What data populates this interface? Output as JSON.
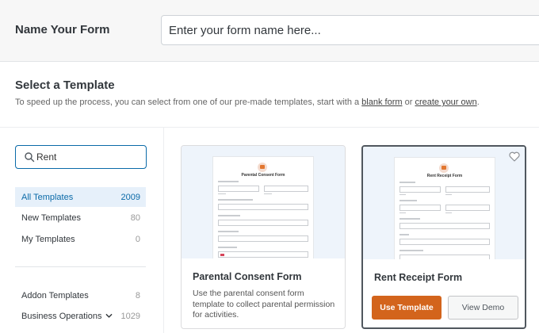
{
  "name_form": {
    "label": "Name Your Form",
    "placeholder": "Enter your form name here...",
    "value": ""
  },
  "templates_section": {
    "title": "Select a Template",
    "subtitle_pre": "To speed up the process, you can select from one of our pre-made templates, start with a ",
    "blank_link": "blank form",
    "subtitle_mid": " or ",
    "own_link": "create your own",
    "subtitle_post": "."
  },
  "search": {
    "value": "Rent",
    "icon": "search-icon"
  },
  "categories": [
    {
      "label": "All Templates",
      "count": "2009",
      "active": true
    },
    {
      "label": "New Templates",
      "count": "80"
    },
    {
      "label": "My Templates",
      "count": "0"
    },
    {
      "label": "Addon Templates",
      "count": "8"
    },
    {
      "label": "Business Operations",
      "count": "1029",
      "icon": "chevron-down-icon"
    }
  ],
  "cards": [
    {
      "title": "Parental Consent Form",
      "description": "Use the parental consent form template to collect parental permission for activities.",
      "preview": {
        "form_title": "Parental Consent Form",
        "fields": [
          "Child's Name *",
          "First",
          "Last",
          "Child Classroom / Teacher",
          "Parent Name *",
          "Parent Email *",
          "Parent Phone",
          "Permission for Conduct / Activities"
        ]
      }
    },
    {
      "title": "Rent Receipt Form",
      "preview": {
        "form_title": "Rent Receipt Form",
        "fields": [
          "Date / Time",
          "Date",
          "Time",
          "Tenant Name",
          "First",
          "Last",
          "Tenant Email *",
          "Unit #",
          "Property Address",
          "Address Line 1"
        ]
      },
      "use_label": "Use Template",
      "demo_label": "View Demo",
      "favorite_icon": "heart-icon"
    }
  ],
  "colors": {
    "accent": "#0a6aa8",
    "primary_button": "#d3641c",
    "preview_background": "#eef4fb"
  }
}
